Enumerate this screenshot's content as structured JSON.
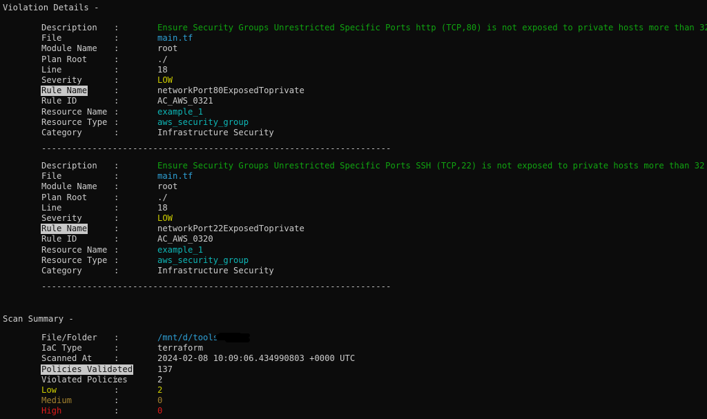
{
  "terminal": {
    "background": "#0c0c0c",
    "foreground": "#cccccc",
    "highlight_bg": "#c9c9c9",
    "highlight_fg": "#101010"
  },
  "violation_details": {
    "header": "Violation Details -",
    "divider": "---------------------------------------------------------------------",
    "violations": [
      {
        "rows": [
          {
            "label": "Description",
            "value": "Ensure Security Groups Unrestricted Specific Ports http (TCP,80) is not exposed to private hosts more than 32",
            "color": "green",
            "highlight": false
          },
          {
            "label": "File",
            "value": "main.tf",
            "color": "cyan",
            "highlight": false
          },
          {
            "label": "Module Name",
            "value": "root",
            "color": "default",
            "highlight": false
          },
          {
            "label": "Plan Root",
            "value": "./",
            "color": "default",
            "highlight": false
          },
          {
            "label": "Line",
            "value": "18",
            "color": "default",
            "highlight": false
          },
          {
            "label": "Severity",
            "value": "LOW",
            "color": "yellow",
            "highlight": false
          },
          {
            "label": "Rule Name",
            "value": "networkPort80ExposedToprivate",
            "color": "default",
            "highlight": true
          },
          {
            "label": "Rule ID",
            "value": "AC_AWS_0321",
            "color": "default",
            "highlight": false
          },
          {
            "label": "Resource Name",
            "value": "example_1",
            "color": "teal",
            "highlight": false
          },
          {
            "label": "Resource Type",
            "value": "aws_security_group",
            "color": "teal",
            "highlight": false
          },
          {
            "label": "Category",
            "value": "Infrastructure Security",
            "color": "default",
            "highlight": false
          }
        ]
      },
      {
        "rows": [
          {
            "label": "Description",
            "value": "Ensure Security Groups Unrestricted Specific Ports SSH (TCP,22) is not exposed to private hosts more than 32",
            "color": "green",
            "highlight": false
          },
          {
            "label": "File",
            "value": "main.tf",
            "color": "cyan",
            "highlight": false
          },
          {
            "label": "Module Name",
            "value": "root",
            "color": "default",
            "highlight": false
          },
          {
            "label": "Plan Root",
            "value": "./",
            "color": "default",
            "highlight": false
          },
          {
            "label": "Line",
            "value": "18",
            "color": "default",
            "highlight": false
          },
          {
            "label": "Severity",
            "value": "LOW",
            "color": "yellow",
            "highlight": false
          },
          {
            "label": "Rule Name",
            "value": "networkPort22ExposedToprivate",
            "color": "default",
            "highlight": true
          },
          {
            "label": "Rule ID",
            "value": "AC_AWS_0320",
            "color": "default",
            "highlight": false
          },
          {
            "label": "Resource Name",
            "value": "example_1",
            "color": "teal",
            "highlight": false
          },
          {
            "label": "Resource Type",
            "value": "aws_security_group",
            "color": "teal",
            "highlight": false
          },
          {
            "label": "Category",
            "value": "Infrastructure Security",
            "color": "default",
            "highlight": false
          }
        ]
      }
    ]
  },
  "scan_summary": {
    "header": "Scan Summary -",
    "rows": [
      {
        "label": "File/Folder",
        "value": "/mnt/d/tools",
        "color": "cyan",
        "highlight": false,
        "redacted": true
      },
      {
        "label": "IaC Type",
        "value": "terraform",
        "color": "default",
        "highlight": false,
        "redacted": false
      },
      {
        "label": "Scanned At",
        "value": "2024-02-08 10:09:06.434990803 +0000 UTC",
        "color": "default",
        "highlight": false,
        "redacted": false
      },
      {
        "label": "Policies Validated",
        "value": "137",
        "color": "default",
        "highlight": true,
        "redacted": false
      },
      {
        "label": "Violated Policies",
        "value": "2",
        "color": "default",
        "highlight": false,
        "redacted": false
      },
      {
        "label": "Low",
        "value": "2",
        "color": "yellow",
        "highlight": false,
        "redacted": false,
        "label_color": "yellow"
      },
      {
        "label": "Medium",
        "value": "0",
        "color": "olive",
        "highlight": false,
        "redacted": false,
        "label_color": "olive"
      },
      {
        "label": "High",
        "value": "0",
        "color": "red",
        "highlight": false,
        "redacted": false,
        "label_color": "red"
      }
    ]
  }
}
